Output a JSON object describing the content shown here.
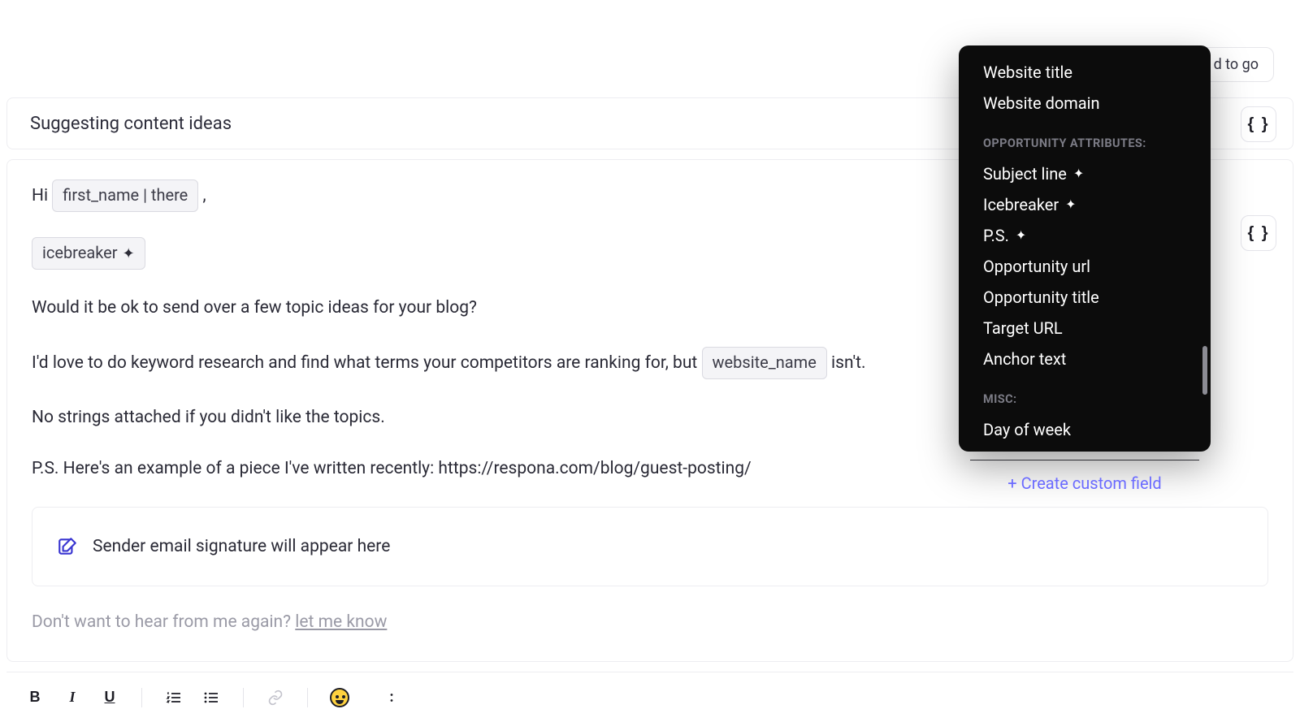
{
  "header": {
    "badge": "d to go"
  },
  "subject": {
    "title": "Suggesting content ideas"
  },
  "chips": {
    "first_name": "first_name | there",
    "icebreaker": "icebreaker",
    "website_name": "website_name"
  },
  "body": {
    "greet_prefix": "Hi ",
    "greet_suffix": " ,",
    "p1": "Would it be ok to send over a few topic ideas for your blog?",
    "p2_pre": "I'd love to do keyword research and find what terms your competitors are ranking for, but ",
    "p2_post": " isn't.",
    "p3": "No strings attached if you didn't like the topics.",
    "p4": "P.S. Here's an example of a piece I've written recently: https://respona.com/blog/guest-posting/"
  },
  "signature": {
    "placeholder": "Sender email signature will appear here"
  },
  "unsub": {
    "lead": "Don't want to hear from me again? ",
    "link": "let me know"
  },
  "vars_dropdown": {
    "group0_items": [
      "Website title",
      "Website domain"
    ],
    "section1": "OPPORTUNITY ATTRIBUTES:",
    "group1_items": [
      "Subject line",
      "Icebreaker",
      "P.S.",
      "Opportunity url",
      "Opportunity title",
      "Target URL",
      "Anchor text"
    ],
    "section2": "MISC:",
    "group2_items": [
      "Day of week"
    ],
    "footer": "+ Create custom field"
  },
  "toolbar": {
    "bold": "B",
    "italic": "I",
    "underline": "U"
  },
  "vars_btn_label": "{ }"
}
